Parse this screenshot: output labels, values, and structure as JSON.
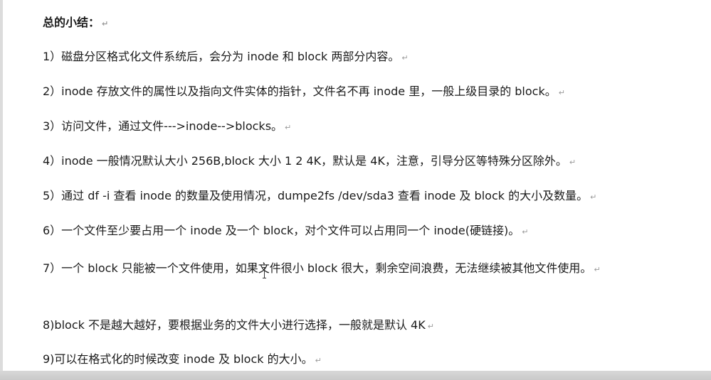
{
  "document": {
    "title": "总的小结：",
    "items": [
      "1）磁盘分区格式化文件系统后，会分为 inode 和 block 两部分内容。",
      "2）inode 存放文件的属性以及指向文件实体的指针，文件名不再 inode 里，一般上级目录的 block。",
      "3）访问文件，通过文件--->inode-->blocks。",
      "4）inode 一般情况默认大小 256B,block 大小 1 2 4K，默认是 4K，注意，引导分区等特殊分区除外。",
      "5）通过 df -i 查看 inode 的数量及使用情况，dumpe2fs /dev/sda3 查看 inode 及 block 的大小及数量。",
      "6）一个文件至少要占用一个 inode 及一个 block，对个文件可以占用同一个 inode(硬链接)。",
      "7）一个 block 只能被一个文件使用，如果文件很小 block 很大，剩余空间浪费，无法继续被其他文件使用。",
      "8)block 不是越大越好，要根据业务的文件大小进行选择，一般就是默认 4K",
      "9)可以在格式化的时候改变 inode 及 block 的大小。"
    ],
    "paragraph_mark": "↵"
  }
}
